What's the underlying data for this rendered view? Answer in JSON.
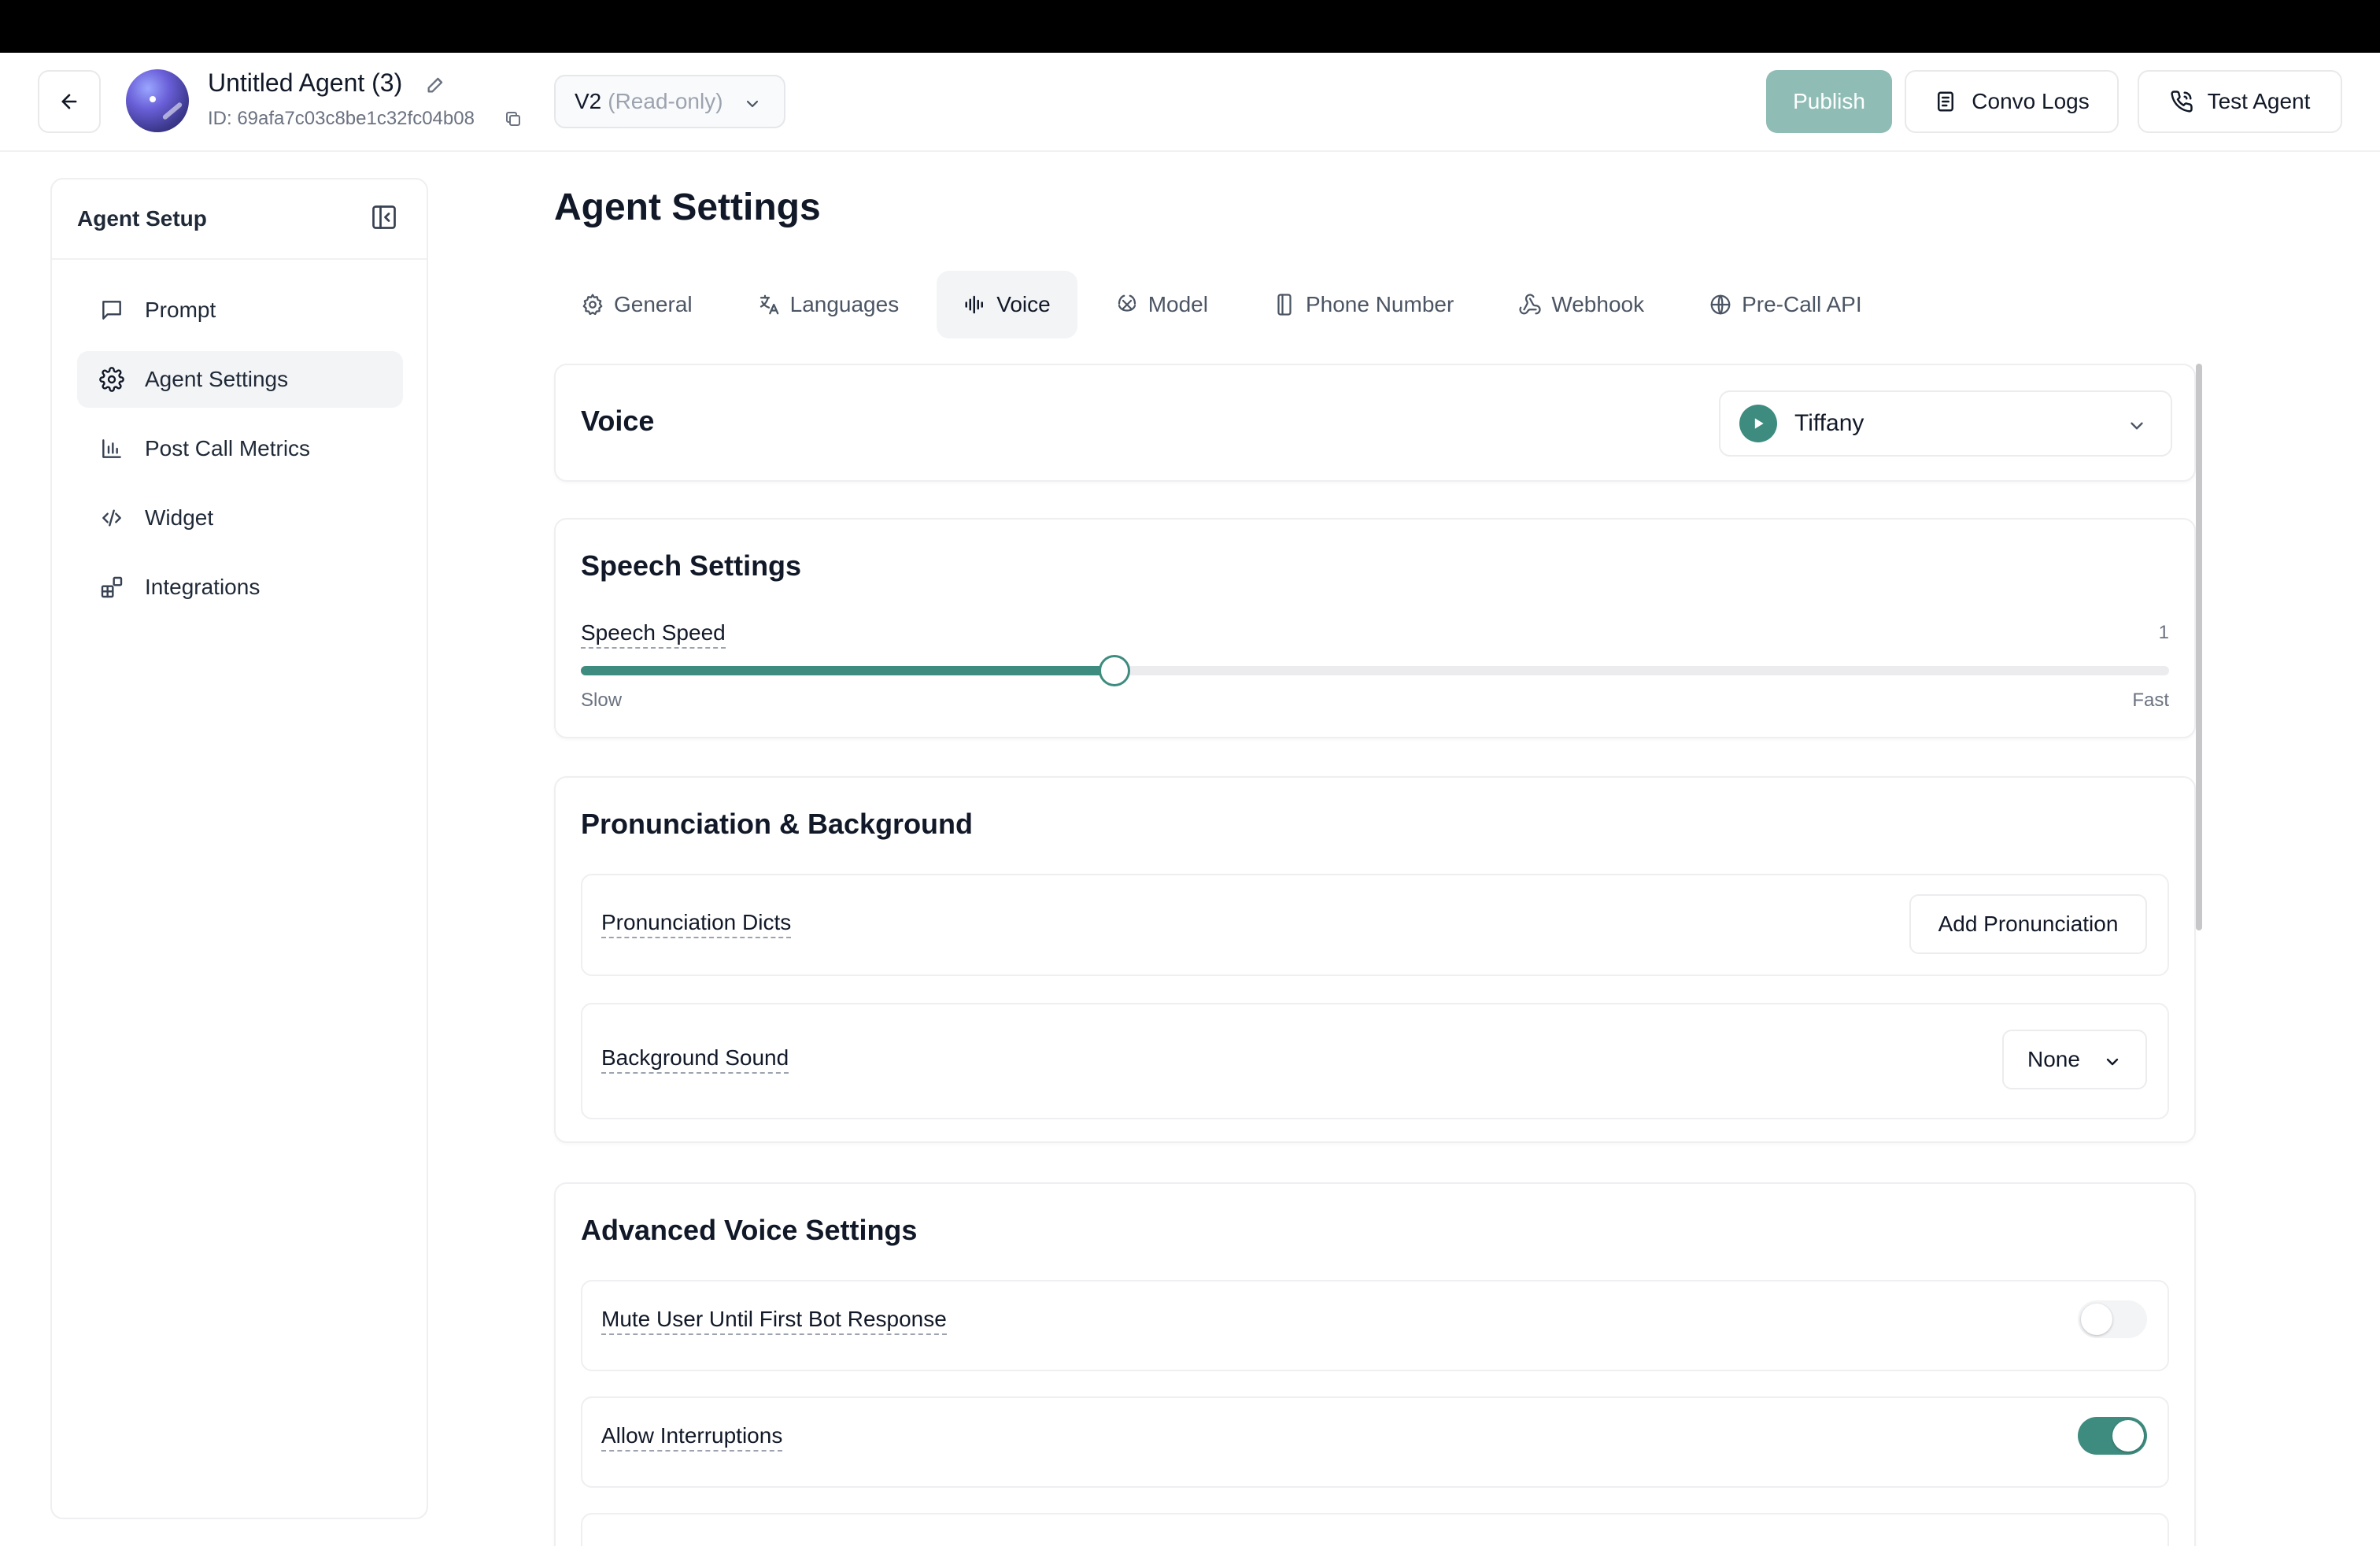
{
  "header": {
    "agent_name": "Untitled Agent (3)",
    "agent_id": "ID: 69afa7c03c8be1c32fc04b08",
    "version": "V2",
    "version_note": "(Read-only)",
    "publish_label": "Publish",
    "convo_logs_label": "Convo Logs",
    "test_agent_label": "Test Agent"
  },
  "sidebar": {
    "title": "Agent Setup",
    "items": [
      {
        "label": "Prompt",
        "icon": "chat-bubble-icon",
        "active": false
      },
      {
        "label": "Agent Settings",
        "icon": "gear-icon",
        "active": true
      },
      {
        "label": "Post Call Metrics",
        "icon": "bar-chart-icon",
        "active": false
      },
      {
        "label": "Widget",
        "icon": "code-icon",
        "active": false
      },
      {
        "label": "Integrations",
        "icon": "blocks-icon",
        "active": false
      }
    ]
  },
  "main": {
    "title": "Agent Settings",
    "tabs": [
      {
        "label": "General",
        "icon": "gear-icon",
        "active": false
      },
      {
        "label": "Languages",
        "icon": "translate-icon",
        "active": false
      },
      {
        "label": "Voice",
        "icon": "waveform-icon",
        "active": true
      },
      {
        "label": "Model",
        "icon": "model-icon",
        "active": false
      },
      {
        "label": "Phone Number",
        "icon": "phone-device-icon",
        "active": false
      },
      {
        "label": "Webhook",
        "icon": "webhook-icon",
        "active": false
      },
      {
        "label": "Pre-Call API",
        "icon": "globe-icon",
        "active": false
      }
    ],
    "voice": {
      "title": "Voice",
      "selected_voice": "Tiffany"
    },
    "speech": {
      "title": "Speech Settings",
      "speed_label": "Speech Speed",
      "speed_value": "1",
      "slider_fraction": 0.336,
      "slow_label": "Slow",
      "fast_label": "Fast"
    },
    "pronunciation": {
      "title": "Pronunciation & Background",
      "dicts_label": "Pronunciation Dicts",
      "add_button": "Add Pronunciation",
      "background_label": "Background Sound",
      "background_value": "None"
    },
    "advanced": {
      "title": "Advanced Voice Settings",
      "mute_label": "Mute User Until First Bot Response",
      "mute_on": false,
      "interrupt_label": "Allow Interruptions",
      "interrupt_on": true
    }
  },
  "colors": {
    "accent": "#3e8c7f",
    "publish_disabled": "#8fbdb5"
  }
}
